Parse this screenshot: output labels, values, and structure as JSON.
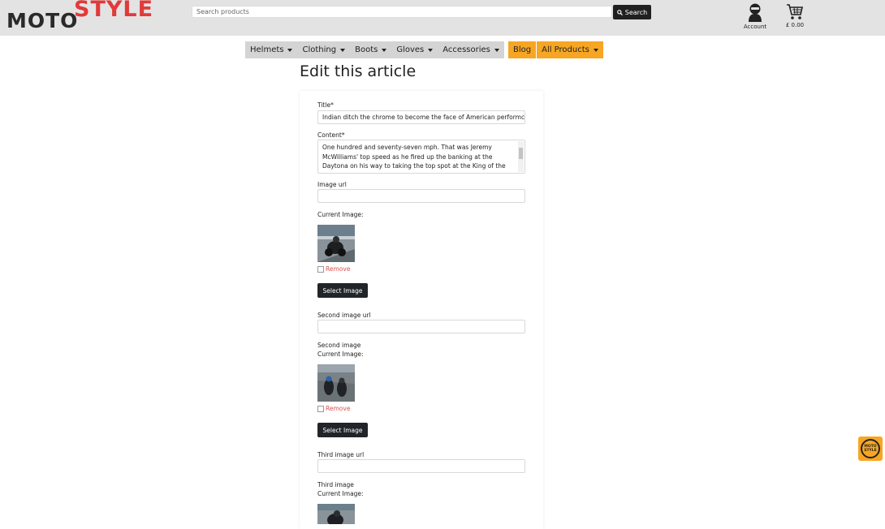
{
  "brand": {
    "part1": "MOTO",
    "part2": "STYLE",
    "badge_line1": "MOTO",
    "badge_line2": "STYLE"
  },
  "search": {
    "placeholder": "Search products",
    "button": "Search",
    "icon": "search-icon"
  },
  "account": {
    "label": "Account",
    "icon": "user-icon"
  },
  "cart": {
    "total": "£ 0.00",
    "icon": "cart-icon"
  },
  "nav": {
    "items": [
      "Helmets",
      "Clothing",
      "Boots",
      "Gloves",
      "Accessories"
    ],
    "blog": "Blog",
    "all_products": "All Products"
  },
  "page": {
    "title": "Edit this article"
  },
  "form": {
    "title_label": "Title*",
    "title_value": "Indian ditch the chrome to become the face of American performc",
    "content_label": "Content*",
    "content_value": "One hundred and seventy-seven mph. That was Jeremy McWilliams' top speed as he fired up the banking at the Daytona on his way to taking the top spot at the King of the",
    "image_url_label": "Image url",
    "current_image_label": "Current Image:",
    "remove_label": "Remove",
    "select_image": "Select Image",
    "second_image_url_label": "Second image url",
    "second_image_label": "Second image",
    "third_image_url_label": "Third image url",
    "third_image_label": "Third image"
  },
  "colors": {
    "accent": "#f6a623",
    "brand_red": "#e23a3a",
    "dark": "#212529",
    "danger": "#d9534f"
  }
}
